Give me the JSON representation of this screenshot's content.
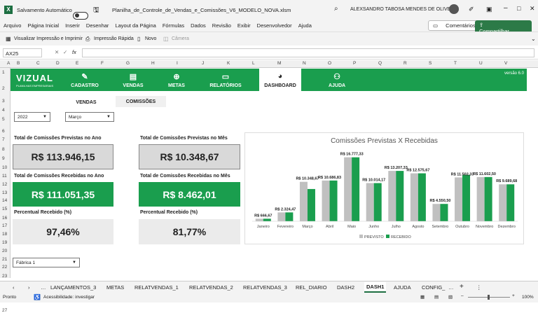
{
  "titlebar": {
    "autosave_label": "Salvamento Automático",
    "filename": "Planilha_de_Controle_de_Vendas_e_Comissões_V6_MODELO_NOVA.xlsm",
    "user_name": "ALEXSANDRO TABOSA MENDES DE OLIVEIRA"
  },
  "menu": {
    "items": [
      "Arquivo",
      "Página Inicial",
      "Inserir",
      "Desenhar",
      "Layout da Página",
      "Fórmulas",
      "Dados",
      "Revisão",
      "Exibir",
      "Desenvolvedor",
      "Ajuda"
    ],
    "comments_label": "Comentários",
    "share_label": "Compartilhar"
  },
  "qat": {
    "print_preview_label": "Visualizar Impressão e Imprimir",
    "quick_print_label": "Impressão Rápida",
    "new_label": "Novo",
    "camera_label": "Câmera"
  },
  "formula_bar": {
    "name_box": "AX25",
    "fx": "fx",
    "formula": ""
  },
  "grid": {
    "columns": [
      "A",
      "B",
      "C",
      "D",
      "E",
      "F",
      "G",
      "H",
      "I",
      "J",
      "K",
      "L",
      "M",
      "N",
      "O",
      "P",
      "Q",
      "R",
      "S",
      "T",
      "U",
      "V"
    ],
    "rows": [
      "1",
      "2",
      "3",
      "4",
      "5",
      "6",
      "7",
      "8",
      "9",
      "10",
      "11",
      "12",
      "13",
      "14",
      "15",
      "16",
      "17",
      "18",
      "19",
      "20",
      "21",
      "22",
      "23",
      "24",
      "25",
      "26",
      "27"
    ]
  },
  "dashboard": {
    "logo_text": "VIZUAL",
    "logo_sub": "PLANILHAS EMPRESARIAIS",
    "version": "versão 6.0",
    "nav": [
      {
        "label": "CADASTRO",
        "icon": "pencil-icon",
        "glyph": "✎"
      },
      {
        "label": "VENDAS",
        "icon": "cart-icon",
        "glyph": "▤"
      },
      {
        "label": "METAS",
        "icon": "globe-icon",
        "glyph": "⊕"
      },
      {
        "label": "RELATÓRIOS",
        "icon": "document-icon",
        "glyph": "▭"
      },
      {
        "label": "DASHBOARD",
        "icon": "pie-chart-icon",
        "glyph": "◕"
      },
      {
        "label": "AJUDA",
        "icon": "people-icon",
        "glyph": "⚇"
      }
    ],
    "subtabs": [
      "VENDAS",
      "COMISSÕES"
    ],
    "year_filter": "2022",
    "month_filter": "Março",
    "kpis": {
      "prev_year_label": "Total de Comissões Previstas no Ano",
      "prev_year_value": "R$ 113.946,15",
      "prev_month_label": "Total de Comissões Previstas no Mês",
      "prev_month_value": "R$ 10.348,67",
      "rec_year_label": "Total de Comissões Recebidas no Ano",
      "rec_year_value": "R$ 111.051,35",
      "rec_month_label": "Total de Comissões Recebidas no Mês",
      "rec_month_value": "R$ 8.462,01",
      "pct_year_label": "Percentual Recebido (%)",
      "pct_year_value": "97,46%",
      "pct_month_label": "Percentual Recebido (%)",
      "pct_month_value": "81,77%"
    },
    "factory_filter": "Fábrica 1"
  },
  "chart_data": {
    "type": "bar",
    "title": "Comissões Previstas X Recebidas",
    "categories": [
      "Janeiro",
      "Fevereiro",
      "Março",
      "Abril",
      "Maio",
      "Junho",
      "Julho",
      "Agosto",
      "Setembro",
      "Outubro",
      "Novembro",
      "Dezembro"
    ],
    "data_labels": [
      "R$ 666,67",
      "R$ 2.324,47",
      "R$ 10.348,67",
      "R$ 10.686,83",
      "R$ 16.777,33",
      "R$ 10.014,17",
      "R$ 13.207,33",
      "R$ 12.575,67",
      "R$ 4.550,50",
      "R$ 11.502,33",
      "R$ 11.602,50",
      "R$ 9.689,68"
    ],
    "series": [
      {
        "name": "PREVISTO",
        "color": "#c0c0c0",
        "values": [
          666.67,
          2324.47,
          10348.67,
          10686.83,
          16777.33,
          10014.17,
          13207.33,
          12575.67,
          4550.5,
          11502.33,
          11602.5,
          9689.68
        ]
      },
      {
        "name": "RECEBIDO",
        "color": "#1a9e4e",
        "values": [
          666.67,
          2324.47,
          8462.01,
          10686.83,
          16777.33,
          10014.17,
          13207.33,
          12575.67,
          4550.5,
          12200,
          11602.5,
          9689.68
        ]
      }
    ],
    "ylim": [
      0,
      18000
    ],
    "grid": false,
    "legend": "bottom"
  },
  "sheet_tabs": [
    "LANÇAMENTOS_3",
    "METAS",
    "RELATVENDAS_1",
    "RELATVENDAS_2",
    "RELATVENDAS_3",
    "REL_DIARIO",
    "DASH2",
    "DASH1",
    "AJUDA",
    "CONFIG_"
  ],
  "active_sheet": "DASH1",
  "status": {
    "ready": "Pronto",
    "accessibility": "Acessibilidade: investigar",
    "zoom": "100%"
  }
}
